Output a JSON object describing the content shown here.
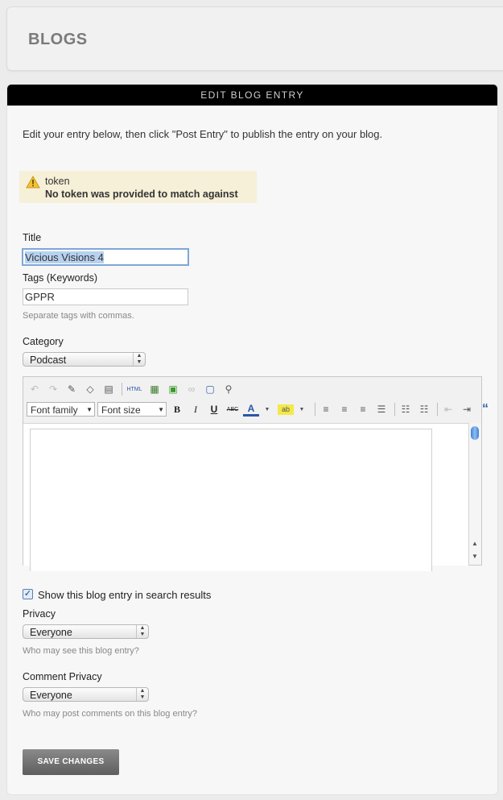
{
  "header": {
    "title": "BLOGS"
  },
  "panel": {
    "title": "EDIT BLOG ENTRY"
  },
  "intro": "Edit your entry below, then click \"Post Entry\" to publish the entry on your blog.",
  "warning": {
    "key": "token",
    "message": "No token was provided to match against"
  },
  "form": {
    "title_label": "Title",
    "title_value": "Vicious Visions 4",
    "tags_label": "Tags (Keywords)",
    "tags_value": "GPPR",
    "tags_hint": "Separate tags with commas.",
    "category_label": "Category",
    "category_value": "Podcast",
    "search_label": "Show this blog entry in search results",
    "search_checked": true,
    "privacy_label": "Privacy",
    "privacy_value": "Everyone",
    "privacy_hint": "Who may see this blog entry?",
    "comment_privacy_label": "Comment Privacy",
    "comment_privacy_value": "Everyone",
    "comment_privacy_hint": "Who may post comments on this blog entry?",
    "save_label": "SAVE CHANGES"
  },
  "editor": {
    "font_family": "Font family",
    "font_size": "Font size",
    "html_label": "HTML",
    "bold": "B",
    "italic": "I",
    "underline": "U",
    "strike": "ABC",
    "font_color": "A",
    "highlight": "ab",
    "quote": "“"
  }
}
